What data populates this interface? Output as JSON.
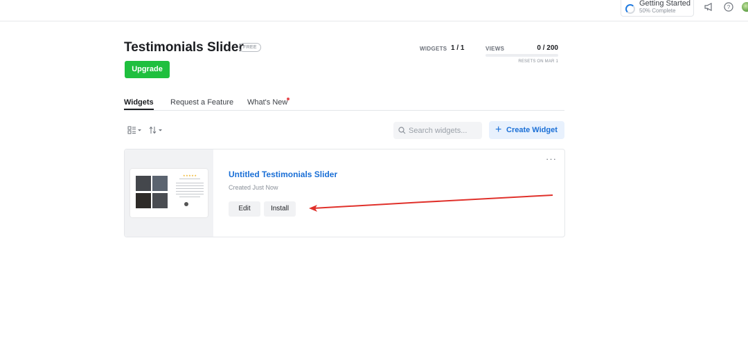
{
  "topbar": {
    "getting_started": {
      "title": "Getting Started",
      "progress_text": "50% Complete",
      "progress": 0.5
    },
    "icons": [
      "announcement-icon",
      "help-icon",
      "avatar"
    ]
  },
  "header": {
    "title": "Testimonials Slider",
    "plan_badge": "FREE",
    "upgrade_label": "Upgrade",
    "stats": {
      "widgets_label": "WIDGETS",
      "widgets_value": "1 / 1",
      "views_label": "VIEWS",
      "views_value": "0 / 200",
      "views_progress": 0,
      "resets_text": "RESETS ON MAR 1"
    }
  },
  "tabs": [
    {
      "label": "Widgets",
      "active": true
    },
    {
      "label": "Request a Feature",
      "active": false
    },
    {
      "label": "What's New",
      "active": false,
      "has_notification": true
    }
  ],
  "toolbar": {
    "search_placeholder": "Search widgets...",
    "create_label": "Create Widget"
  },
  "widgets": [
    {
      "title": "Untitled Testimonials Slider",
      "subtitle": "Created Just Now",
      "edit_label": "Edit",
      "install_label": "Install",
      "more_label": "···"
    }
  ],
  "colors": {
    "accent": "#1a6fd6",
    "upgrade": "#1fbf3e",
    "annotation_arrow": "#e0302a"
  }
}
